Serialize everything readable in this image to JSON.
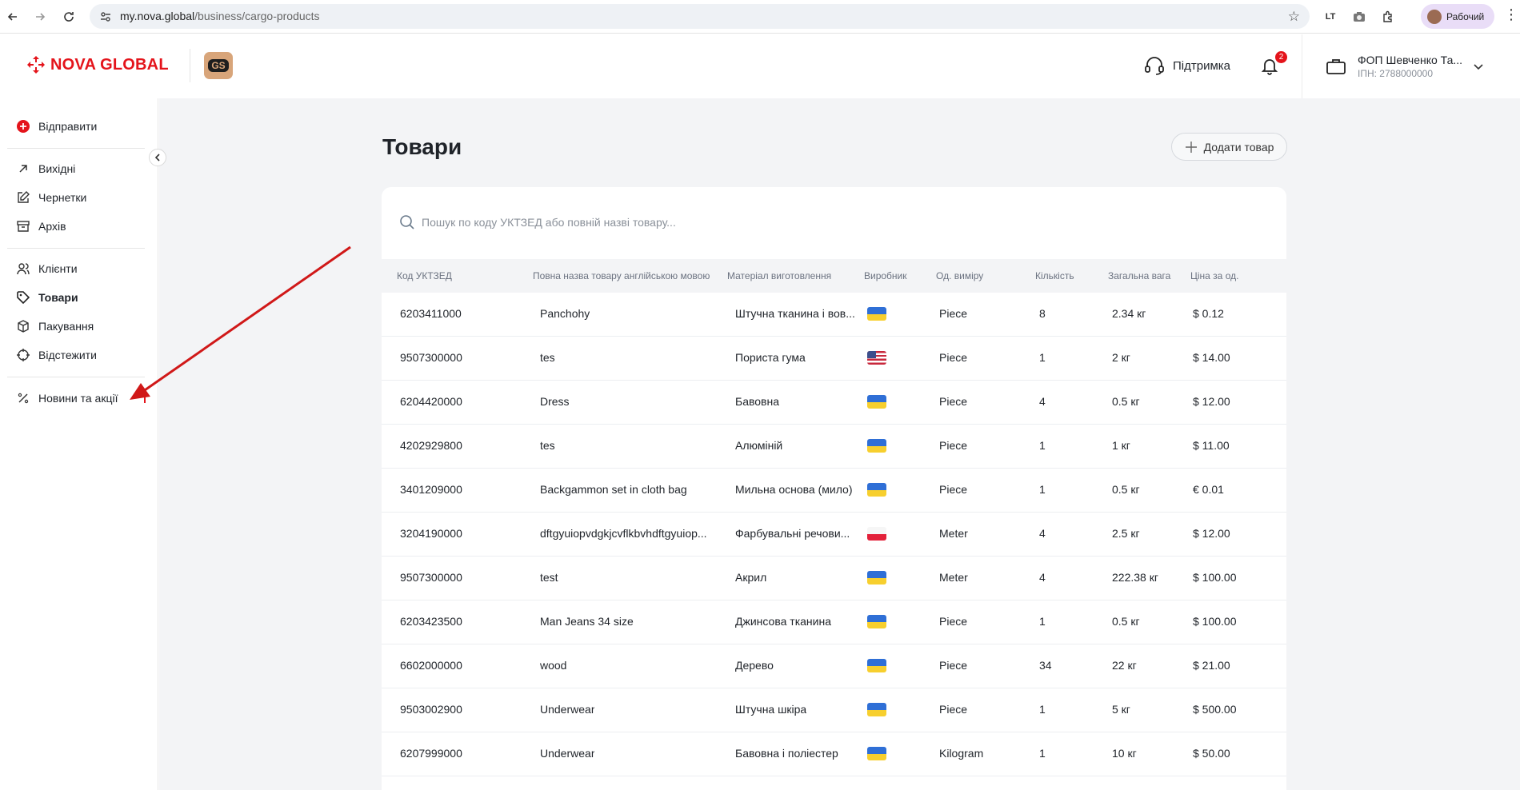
{
  "browser": {
    "url_host": "my.nova.global",
    "url_path": "/business/cargo-products",
    "profile_label": "Рабочий"
  },
  "header": {
    "logo_text": "NOVA GLOBAL",
    "gs_badge": "GS",
    "support_label": "Підтримка",
    "notification_count": "2",
    "account_name": "ФОП Шевченко Та...",
    "account_ipn": "ІПН: 2788000000"
  },
  "sidebar": {
    "send_label": "Відправити",
    "items": [
      {
        "label": "Вихідні",
        "icon": "arrow-up-right-icon"
      },
      {
        "label": "Чернетки",
        "icon": "edit-icon"
      },
      {
        "label": "Архів",
        "icon": "archive-icon"
      },
      {
        "label": "Клієнти",
        "icon": "users-icon"
      },
      {
        "label": "Товари",
        "icon": "tag-icon",
        "active": true
      },
      {
        "label": "Пакування",
        "icon": "box-icon"
      },
      {
        "label": "Відстежити",
        "icon": "target-icon"
      },
      {
        "label": "Новини та акції",
        "icon": "percent-icon"
      }
    ]
  },
  "main": {
    "title": "Товари",
    "add_button": "Додати товар",
    "search_placeholder": "Пошук по коду УКТЗЕД або повній назві товару...",
    "columns": [
      "Код УКТЗЕД",
      "Повна назва товару англійською мовою",
      "Матеріал виготовлення",
      "Виробник",
      "Од. виміру",
      "Кількість",
      "Загальна вага",
      "Ціна за од."
    ],
    "rows": [
      {
        "code": "6203411000",
        "name": "Panchohy",
        "material": "Штучна тканина і вов...",
        "flag": "UA",
        "unit": "Piece",
        "qty": "8",
        "weight": "2.34 кг",
        "price": "$ 0.12"
      },
      {
        "code": "9507300000",
        "name": "tes",
        "material": "Пориста гума",
        "flag": "US",
        "unit": "Piece",
        "qty": "1",
        "weight": "2 кг",
        "price": "$ 14.00"
      },
      {
        "code": "6204420000",
        "name": "Dress",
        "material": "Бавовна",
        "flag": "UA",
        "unit": "Piece",
        "qty": "4",
        "weight": "0.5 кг",
        "price": "$ 12.00"
      },
      {
        "code": "4202929800",
        "name": "tes",
        "material": "Алюміній",
        "flag": "UA",
        "unit": "Piece",
        "qty": "1",
        "weight": "1 кг",
        "price": "$ 11.00"
      },
      {
        "code": "3401209000",
        "name": "Backgammon set in cloth bag",
        "material": "Мильна основа (мило)",
        "flag": "UA",
        "unit": "Piece",
        "qty": "1",
        "weight": "0.5 кг",
        "price": "€ 0.01"
      },
      {
        "code": "3204190000",
        "name": "dftgyuiopvdgkjcvflkbvhdftgyuiop...",
        "material": "Фарбувальні речови...",
        "flag": "PL",
        "unit": "Meter",
        "qty": "4",
        "weight": "2.5 кг",
        "price": "$ 12.00"
      },
      {
        "code": "9507300000",
        "name": "test",
        "material": "Акрил",
        "flag": "UA",
        "unit": "Meter",
        "qty": "4",
        "weight": "222.38 кг",
        "price": "$ 100.00"
      },
      {
        "code": "6203423500",
        "name": "Man Jeans 34 size",
        "material": "Джинсова тканина",
        "flag": "UA",
        "unit": "Piece",
        "qty": "1",
        "weight": "0.5 кг",
        "price": "$ 100.00"
      },
      {
        "code": "6602000000",
        "name": "wood",
        "material": "Дерево",
        "flag": "UA",
        "unit": "Piece",
        "qty": "34",
        "weight": "22 кг",
        "price": "$ 21.00"
      },
      {
        "code": "9503002900",
        "name": "Underwear",
        "material": "Штучна шкіра",
        "flag": "UA",
        "unit": "Piece",
        "qty": "1",
        "weight": "5 кг",
        "price": "$ 500.00"
      },
      {
        "code": "6207999000",
        "name": "Underwear",
        "material": "Бавовна і поліестер",
        "flag": "UA",
        "unit": "Kilogram",
        "qty": "1",
        "weight": "10 кг",
        "price": "$ 50.00"
      }
    ]
  },
  "colors": {
    "brand_red": "#e4141b",
    "annotation_arrow": "#d01818",
    "background": "#f3f4f6"
  }
}
